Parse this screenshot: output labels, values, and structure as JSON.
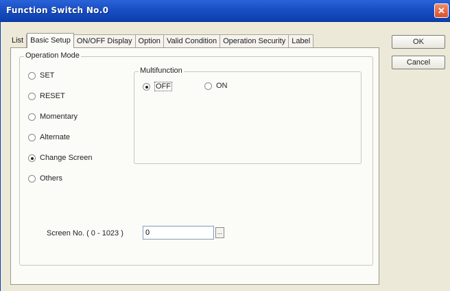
{
  "window": {
    "title": "Function Switch No.0",
    "close_symbol": "✕"
  },
  "tabs": [
    {
      "label": "List"
    },
    {
      "label": "Basic Setup"
    },
    {
      "label": "ON/OFF Display"
    },
    {
      "label": "Option"
    },
    {
      "label": "Valid Condition"
    },
    {
      "label": "Operation Security"
    },
    {
      "label": "Label"
    }
  ],
  "active_tab": "Basic Setup",
  "operation_mode": {
    "title": "Operation Mode",
    "options": [
      "SET",
      "RESET",
      "Momentary",
      "Alternate",
      "Change Screen",
      "Others"
    ],
    "selected": "Change Screen"
  },
  "multifunction": {
    "title": "Multifunction",
    "options": [
      "OFF",
      "ON"
    ],
    "selected": "OFF"
  },
  "screen_no": {
    "label": "Screen No. ( 0 - 1023 )",
    "value": "0",
    "browse_label": "..."
  },
  "buttons": {
    "ok": "OK",
    "cancel": "Cancel"
  },
  "colors": {
    "titlebar": "#1a4fc4",
    "dialog_bg": "#ece9d8",
    "panel_bg": "#fbfbf8"
  }
}
